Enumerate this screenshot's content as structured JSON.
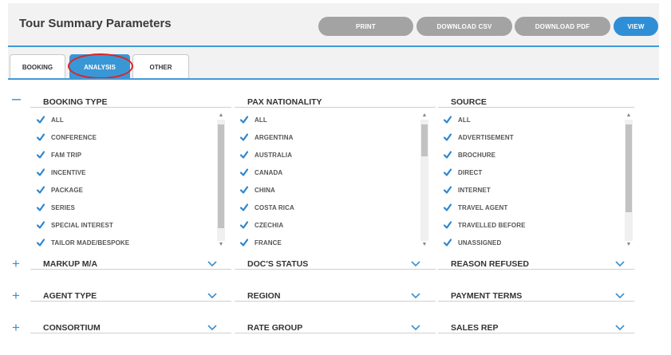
{
  "header": {
    "title": "Tour Summary Parameters",
    "buttons": {
      "print": "PRINT",
      "download_csv": "DOWNLOAD CSV",
      "download_pdf": "DOWNLOAD PDF",
      "view": "VIEW"
    }
  },
  "tabs": [
    {
      "label": "BOOKING",
      "active": false
    },
    {
      "label": "ANALYSIS",
      "active": true
    },
    {
      "label": "OTHER",
      "active": false
    }
  ],
  "expanded": {
    "booking_type": {
      "title": "BOOKING TYPE",
      "items": [
        "ALL",
        "CONFERENCE",
        "FAM TRIP",
        "INCENTIVE",
        "PACKAGE",
        "SERIES",
        "SPECIAL INTEREST",
        "TAILOR MADE/BESPOKE"
      ]
    },
    "pax_nationality": {
      "title": "PAX NATIONALITY",
      "items": [
        "ALL",
        "ARGENTINA",
        "AUSTRALIA",
        "CANADA",
        "CHINA",
        "COSTA RICA",
        "CZECHIA",
        "FRANCE"
      ]
    },
    "source": {
      "title": "SOURCE",
      "items": [
        "ALL",
        "ADVERTISEMENT",
        "BROCHURE",
        "DIRECT",
        "INTERNET",
        "TRAVEL AGENT",
        "TRAVELLED BEFORE",
        "UNASSIGNED"
      ]
    }
  },
  "collapsed_rows": [
    [
      "MARKUP M/A",
      "DOC'S STATUS",
      "REASON REFUSED"
    ],
    [
      "AGENT TYPE",
      "REGION",
      "PAYMENT TERMS"
    ],
    [
      "CONSORTIUM",
      "RATE GROUP",
      "SALES REP"
    ]
  ],
  "colors": {
    "accent": "#2e8fd6",
    "button_grey": "#a3a3a3",
    "annotation": "#d8262b"
  }
}
